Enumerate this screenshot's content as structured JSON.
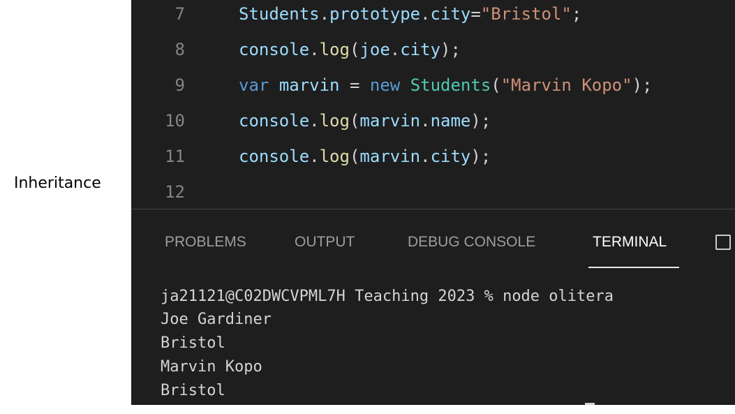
{
  "slide_label": "Inheritance",
  "editor": {
    "lines": [
      {
        "number": "7",
        "tokens": [
          {
            "t": "Students",
            "c": "var"
          },
          {
            "t": ".",
            "c": "p"
          },
          {
            "t": "prototype",
            "c": "var"
          },
          {
            "t": ".",
            "c": "p"
          },
          {
            "t": "city",
            "c": "var"
          },
          {
            "t": "=",
            "c": "p"
          },
          {
            "t": "\"Bristol\"",
            "c": "str"
          },
          {
            "t": ";",
            "c": "p"
          }
        ]
      },
      {
        "number": "8",
        "tokens": [
          {
            "t": "console",
            "c": "var"
          },
          {
            "t": ".",
            "c": "p"
          },
          {
            "t": "log",
            "c": "fn"
          },
          {
            "t": "(",
            "c": "p"
          },
          {
            "t": "joe",
            "c": "var"
          },
          {
            "t": ".",
            "c": "p"
          },
          {
            "t": "city",
            "c": "var"
          },
          {
            "t": ");",
            "c": "p"
          }
        ]
      },
      {
        "number": "9",
        "tokens": [
          {
            "t": "var",
            "c": "kw"
          },
          {
            "t": " ",
            "c": "p"
          },
          {
            "t": "marvin",
            "c": "var"
          },
          {
            "t": " = ",
            "c": "p"
          },
          {
            "t": "new",
            "c": "kw"
          },
          {
            "t": " ",
            "c": "p"
          },
          {
            "t": "Students",
            "c": "cls"
          },
          {
            "t": "(",
            "c": "p"
          },
          {
            "t": "\"Marvin Kopo\"",
            "c": "str"
          },
          {
            "t": ");",
            "c": "p"
          }
        ]
      },
      {
        "number": "10",
        "tokens": [
          {
            "t": "console",
            "c": "var"
          },
          {
            "t": ".",
            "c": "p"
          },
          {
            "t": "log",
            "c": "fn"
          },
          {
            "t": "(",
            "c": "p"
          },
          {
            "t": "marvin",
            "c": "var"
          },
          {
            "t": ".",
            "c": "p"
          },
          {
            "t": "name",
            "c": "var"
          },
          {
            "t": ");",
            "c": "p"
          }
        ]
      },
      {
        "number": "11",
        "tokens": [
          {
            "t": "console",
            "c": "var"
          },
          {
            "t": ".",
            "c": "p"
          },
          {
            "t": "log",
            "c": "fn"
          },
          {
            "t": "(",
            "c": "p"
          },
          {
            "t": "marvin",
            "c": "var"
          },
          {
            "t": ".",
            "c": "p"
          },
          {
            "t": "city",
            "c": "var"
          },
          {
            "t": ");",
            "c": "p"
          }
        ]
      },
      {
        "number": "12",
        "tokens": []
      }
    ]
  },
  "panel": {
    "tabs": [
      {
        "label": "PROBLEMS",
        "active": false
      },
      {
        "label": "OUTPUT",
        "active": false
      },
      {
        "label": "DEBUG CONSOLE",
        "active": false
      },
      {
        "label": "TERMINAL",
        "active": true
      }
    ],
    "icon": "split-panel-icon"
  },
  "terminal": {
    "lines": [
      "ja21121@C02DWCVPML7H Teaching 2023 % node olitera",
      "Joe Gardiner",
      "Bristol",
      "Marvin Kopo",
      "Bristol"
    ]
  },
  "colors": {
    "background": "#1e1e1e",
    "line_number": "#858585",
    "variable": "#9cdcfe",
    "function": "#dcdcaa",
    "keyword": "#569cd6",
    "class": "#4ec9b0",
    "string": "#ce9178",
    "punctuation": "#d4d4d4",
    "tab_inactive": "#9d9d9d",
    "tab_active": "#ffffff"
  }
}
